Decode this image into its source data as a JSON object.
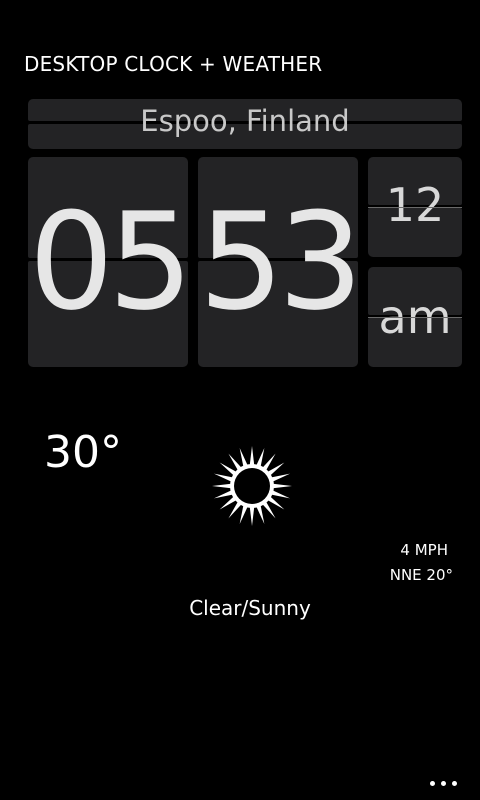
{
  "app": {
    "title": "DESKTOP CLOCK + WEATHER"
  },
  "location": "Espoo, Finland",
  "clock": {
    "hours": "05",
    "minutes": "53",
    "seconds": "12",
    "ampm": "am"
  },
  "weather": {
    "temperature": "30°",
    "icon": "sun-icon",
    "wind_speed": "4 MPH",
    "wind_direction": "NNE 20°",
    "condition": "Clear/Sunny"
  },
  "appbar": {
    "more_icon": "ellipsis-icon"
  },
  "colors": {
    "background": "#000000",
    "tile": "#232325",
    "digit": "#e6e6e6",
    "text": "#ffffff"
  }
}
